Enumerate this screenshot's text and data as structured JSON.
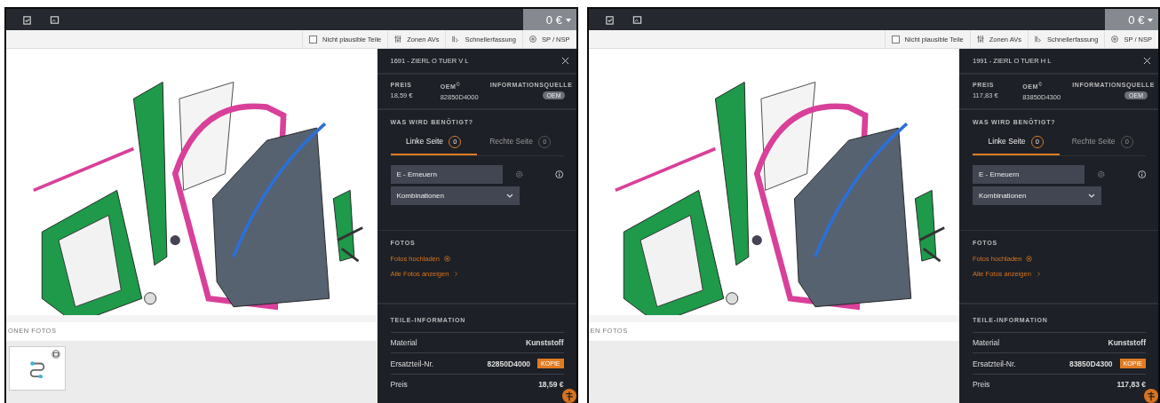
{
  "screens": [
    {
      "total": "0 €",
      "tools": [
        {
          "kind": "checkbox",
          "label": "Nicht plausible Teile",
          "checked": false
        },
        {
          "kind": "sliders",
          "label": "Zonen AVs"
        },
        {
          "kind": "quick",
          "label": "Schnellerfassung"
        },
        {
          "kind": "plus",
          "label": "SP / NSP"
        }
      ],
      "zone_photos_label": "ONEN FOTOS",
      "photo_thumbnail": true,
      "panel": {
        "title": "1691 - ZIERL O TUER V L",
        "price_label": "PREIS",
        "price": "18,59 €",
        "oem_label": "OEM$^{©}$",
        "oem": "82850D4000",
        "source_label": "INFORMATIONSQUELLE",
        "source_badge": "OEM",
        "needed_title": "WAS WIRD BENÖTIGT?",
        "tabs": [
          {
            "label": "Linke Seite",
            "count": "0",
            "selected": true
          },
          {
            "label": "Rechte Seite",
            "count": "0",
            "selected": false
          }
        ],
        "action": "E - Erneuern",
        "combination": "Kombinationen",
        "photos_title": "FOTOS",
        "photo_links": [
          {
            "kind": "upload",
            "label": "Fotos hochladen"
          },
          {
            "kind": "show",
            "label": "Alle Fotos anzeigen"
          }
        ],
        "info_title": "TEILE-INFORMATION",
        "info_rows": [
          {
            "label": "Material",
            "value": "Kunststoff"
          },
          {
            "label": "Ersatzteil-Nr.",
            "value": "82850D4000",
            "badge": "KOPIE"
          },
          {
            "label": "Preis",
            "value": "18,59 €"
          }
        ]
      }
    },
    {
      "total": "0 €",
      "tools": [
        {
          "kind": "checkbox",
          "label": "Nicht plausible Teile",
          "checked": false
        },
        {
          "kind": "sliders",
          "label": "Zonen AVs"
        },
        {
          "kind": "quick",
          "label": "Schnellerfassung"
        },
        {
          "kind": "plus",
          "label": "SP / NSP"
        }
      ],
      "zone_photos_label": "EN FOTOS",
      "photo_thumbnail": false,
      "panel": {
        "title": "1991 - ZIERL O TUER H L",
        "price_label": "PREIS",
        "price": "117,83 €",
        "oem_label": "OEM$^{©}$",
        "oem": "83850D4300",
        "source_label": "INFORMATIONSQUELLE",
        "source_badge": "OEM",
        "needed_title": "WAS WIRD BENÖTIGT?",
        "tabs": [
          {
            "label": "Linke Seite",
            "count": "0",
            "selected": true
          },
          {
            "label": "Rechte Seite",
            "count": "0",
            "selected": false
          }
        ],
        "action": "E - Erneuern",
        "combination": "Kombinationen",
        "photos_title": "FOTOS",
        "photo_links": [
          {
            "kind": "upload",
            "label": "Fotos hochladen"
          },
          {
            "kind": "show",
            "label": "Alle Fotos anzeigen"
          }
        ],
        "info_title": "TEILE-INFORMATION",
        "info_rows": [
          {
            "label": "Material",
            "value": "Kunststoff"
          },
          {
            "label": "Ersatzteil-Nr.",
            "value": "83850D4300",
            "badge": "KOPIE"
          },
          {
            "label": "Preis",
            "value": "117,83 €"
          }
        ]
      }
    }
  ]
}
